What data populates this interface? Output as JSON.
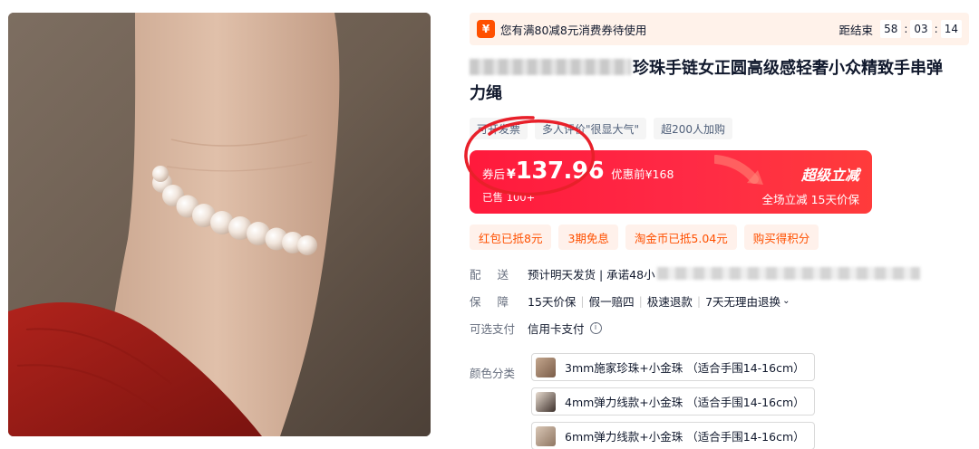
{
  "coupon_bar": {
    "icon": "coupon-icon",
    "icon_glyph": "¥",
    "text": "您有满80减8元消费券待使用",
    "countdown_label": "距结束",
    "hours": "58",
    "minutes": "03",
    "seconds": "14"
  },
  "product": {
    "title_visible": "珍珠手链女正圆高级感轻奢小众精致手串弹力绳"
  },
  "tags": [
    "可开发票",
    "多人评价\"很显大气\"",
    "超200人加购"
  ],
  "price": {
    "prefix": "券后",
    "currency": "¥",
    "value": "137.96",
    "original": "优惠前¥168",
    "sold": "已售 100+",
    "super_label": "超级立减",
    "promo_sub": "全场立减 15天价保"
  },
  "benefits": [
    "红包已抵8元",
    "3期免息",
    "淘金币已抵5.04元",
    "购买得积分"
  ],
  "delivery": {
    "label": "配送",
    "value": "预计明天发货 | 承诺48小"
  },
  "guarantee": {
    "label": "保障",
    "items": [
      "15天价保",
      "假一赔四",
      "极速退款",
      "7天无理由退换"
    ],
    "chevron": "⌄"
  },
  "payment": {
    "label": "可选支付",
    "value": "信用卡支付",
    "info_icon": "i"
  },
  "sku": {
    "label": "颜色分类",
    "options": [
      {
        "text": "3mm施家珍珠+小金珠 （适合手围14-16cm）",
        "thumb_color": "#9a7a62"
      },
      {
        "text": "4mm弹力线款+小金珠 （适合手围14-16cm）",
        "thumb_color": "#5b4a44"
      },
      {
        "text": "6mm弹力线款+小金珠 （适合手围14-16cm）",
        "thumb_color": "#b59d86"
      }
    ]
  },
  "colors": {
    "accent_orange": "#ff5000",
    "price_red": "#ff1a3c",
    "annotation_red": "#e8202a"
  }
}
